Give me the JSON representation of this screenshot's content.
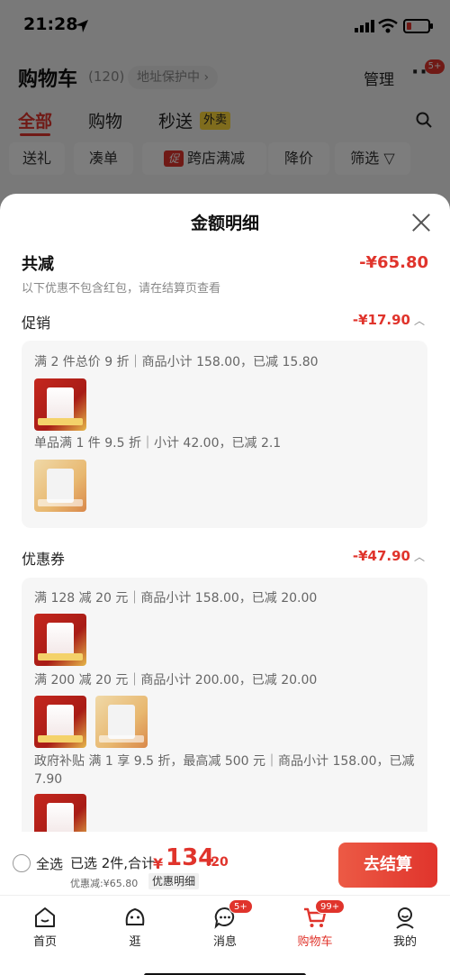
{
  "status_bar": {
    "time": "21:28"
  },
  "header": {
    "title": "购物车",
    "count": "(120)",
    "address_protection": "地址保护中",
    "manage": "管理",
    "more_badge": "5+"
  },
  "tabs": [
    {
      "label": "全部"
    },
    {
      "label": "购物"
    },
    {
      "label": "秒送"
    }
  ],
  "takeout_badge": "外卖",
  "filters": [
    {
      "label": "送礼"
    },
    {
      "label": "凑单"
    },
    {
      "label": "跨店满减",
      "mark": "促"
    },
    {
      "label": "降价"
    },
    {
      "label": "筛选"
    }
  ],
  "sheet": {
    "title": "金额明细",
    "total_label": "共减",
    "total_value": "-¥65.80",
    "total_note": "以下优惠不包含红包，请在结算页查看",
    "promotion": {
      "label": "促销",
      "value": "-¥17.90",
      "lines": [
        "满 2 件总价 9 折｜商品小计 158.00，已减 15.80",
        "单品满 1 件 9.5 折｜小计 42.00，已减 2.1"
      ]
    },
    "coupon": {
      "label": "优惠券",
      "value": "-¥47.90",
      "lines": [
        "满 128 减 20 元｜商品小计 158.00，已减 20.00",
        "满 200 减 20 元｜商品小计 200.00，已减 20.00",
        "政府补贴 满 1 享 9.5 折，最高减 500 元｜商品小计 158.00，已减 7.90"
      ]
    }
  },
  "checkout": {
    "select_all": "全选",
    "selected_info": "已选 2件,合计:",
    "price_symbol": "¥",
    "price_int": "134",
    "price_dec": ".20",
    "discount_note": "优惠减:¥65.80",
    "detail_link": "优惠明细",
    "button": "去结算"
  },
  "tabbar": [
    {
      "label": "首页",
      "icon": "home-icon"
    },
    {
      "label": "逛",
      "icon": "browse-icon"
    },
    {
      "label": "消息",
      "icon": "message-icon",
      "badge": "5+"
    },
    {
      "label": "购物车",
      "icon": "cart-icon",
      "badge": "99+"
    },
    {
      "label": "我的",
      "icon": "profile-icon"
    }
  ]
}
